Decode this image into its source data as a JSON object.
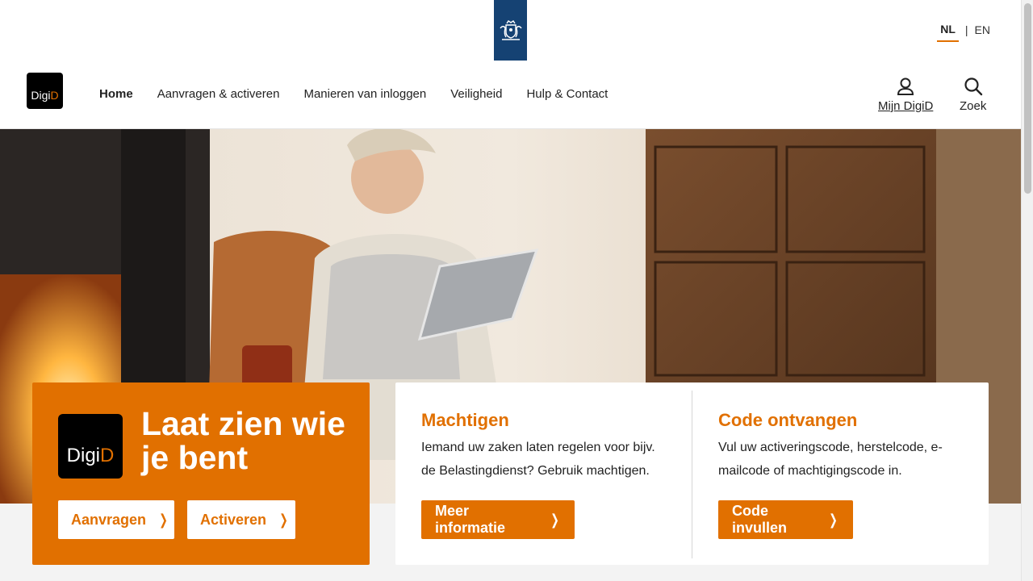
{
  "header": {
    "languages": {
      "nl": "NL",
      "separator": "|",
      "en": "EN"
    },
    "logo_text": {
      "digi": "Digi",
      "d": "D"
    },
    "nav": [
      {
        "label": "Home",
        "active": true
      },
      {
        "label": "Aanvragen & activeren"
      },
      {
        "label": "Manieren van inloggen"
      },
      {
        "label": "Veiligheid"
      },
      {
        "label": "Hulp & Contact"
      }
    ],
    "mijn_digid": "Mijn DigiD",
    "search": "Zoek"
  },
  "hero": {
    "image_description": "woman-with-tablet-by-fireplace"
  },
  "intro": {
    "logo_text": {
      "digi": "Digi",
      "d": "D"
    },
    "tagline": "Laat zien wie je bent",
    "buttons": {
      "apply": "Aanvragen",
      "activate": "Activeren"
    }
  },
  "cards": [
    {
      "title": "Machtigen",
      "text": "Iemand uw zaken laten regelen voor bijv. de Belastingdienst? Gebruik machtigen.",
      "button": "Meer informatie"
    },
    {
      "title": "Code ontvangen",
      "text": "Vul uw activeringscode, herstelcode, e-mailcode of machtigingscode in.",
      "button": "Code invullen"
    }
  ],
  "colors": {
    "brand_orange": "#e17000",
    "gov_blue": "#154273"
  }
}
